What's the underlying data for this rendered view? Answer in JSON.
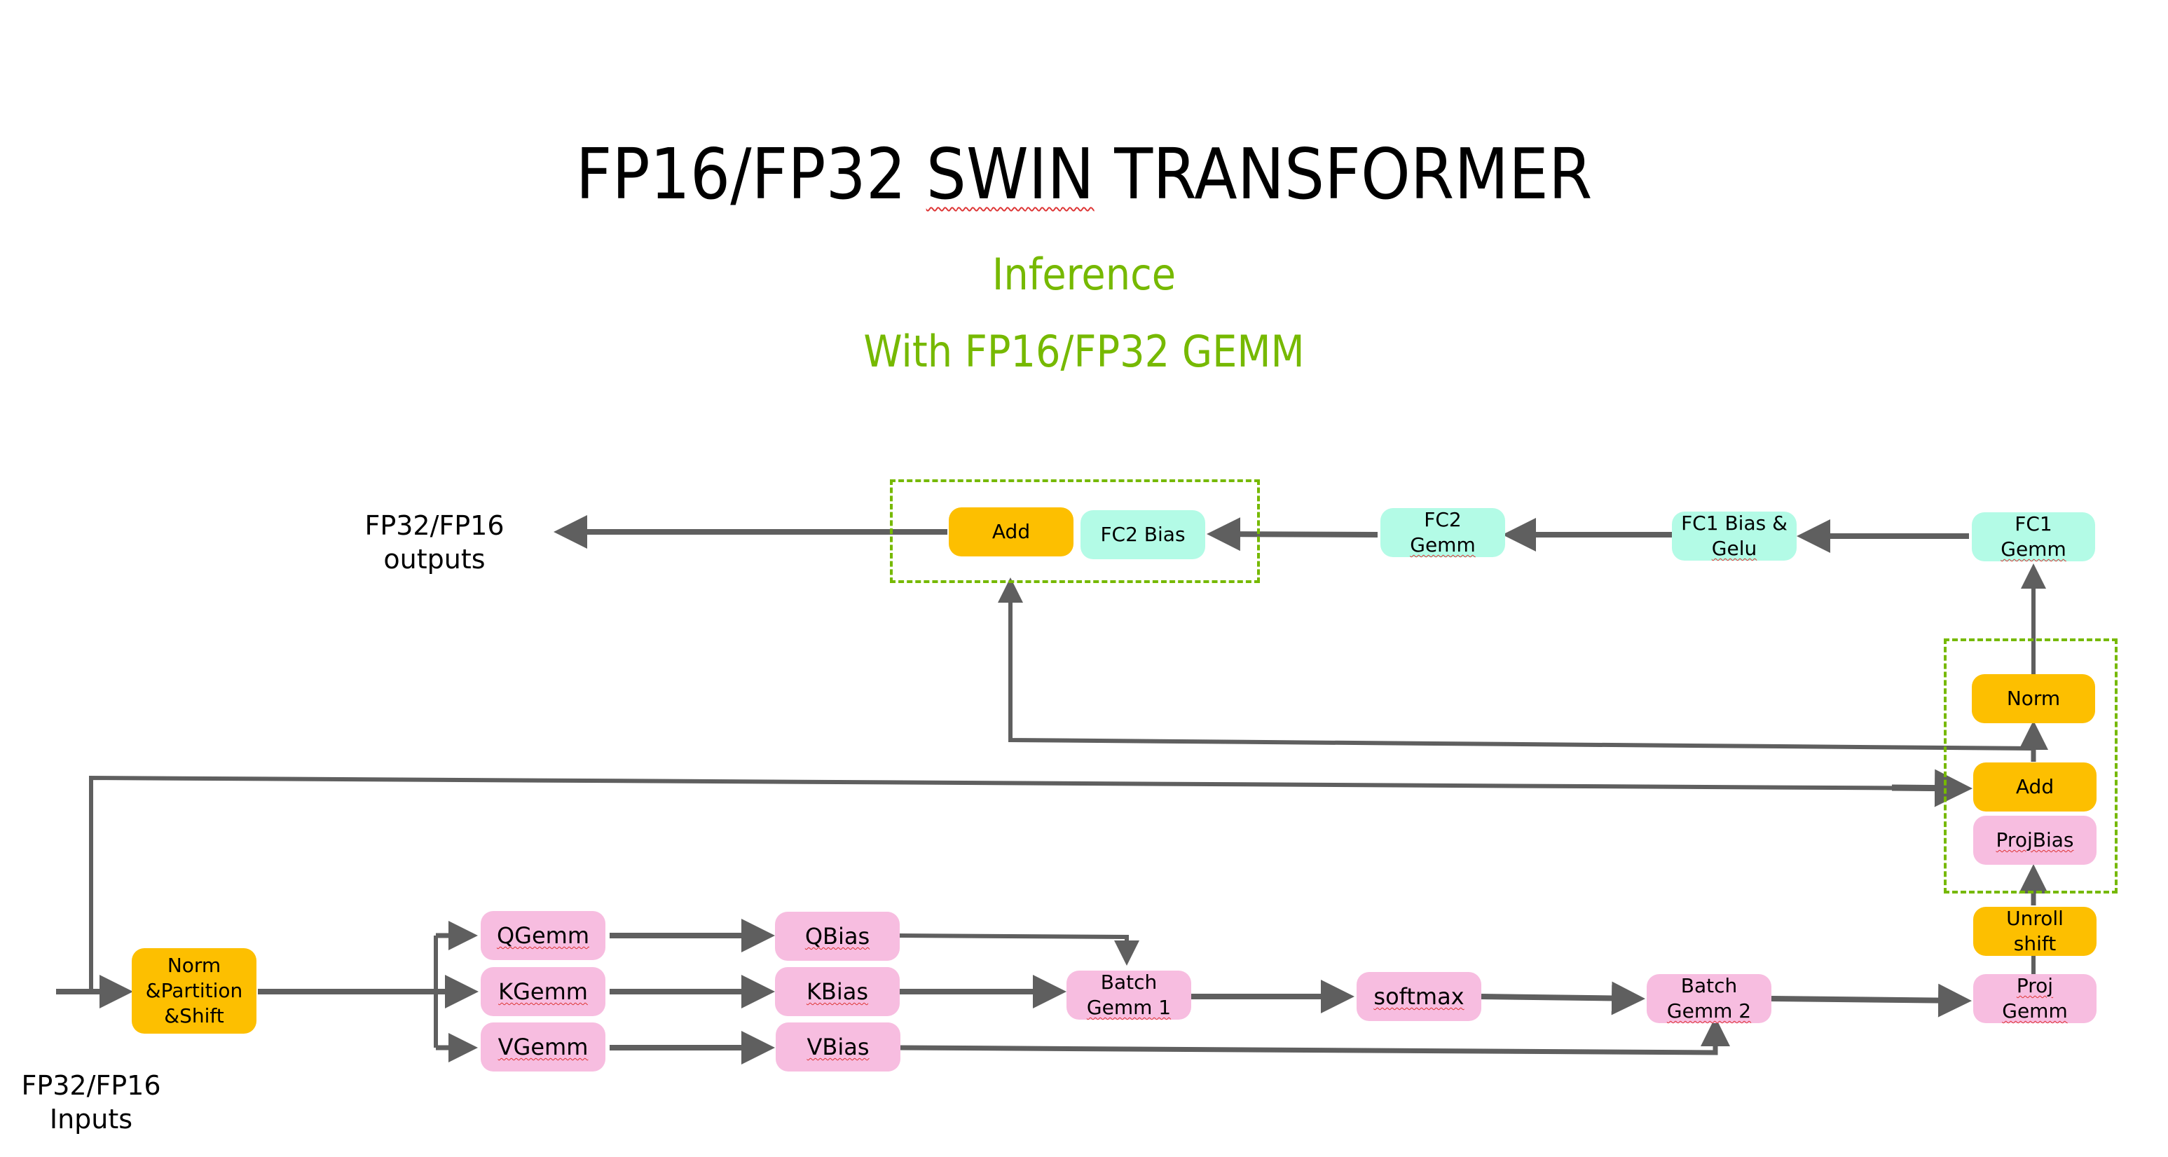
{
  "title": {
    "prefix": "FP16/FP32 ",
    "swin": "SWIN",
    "suffix": " TRANSFORMER"
  },
  "subtitle": {
    "line1": "Inference",
    "line2": "With FP16/FP32 GEMM"
  },
  "colors": {
    "accent_green": "#76b900",
    "orange_block": "#fdbf00",
    "pink_block": "#f7bde0",
    "teal_block": "#b3fbe6",
    "arrow": "#5f5f5f"
  },
  "io": {
    "inputs": {
      "line1": "FP32/FP16",
      "line2": "Inputs"
    },
    "outputs": {
      "line1": "FP32/FP16",
      "line2": "outputs"
    }
  },
  "blocks": {
    "norm_partition_shift": {
      "line1": "Norm",
      "line2": "&Partition",
      "line3": "&Shift"
    },
    "qgemm": "QGemm",
    "kgemm": "KGemm",
    "vgemm": "VGemm",
    "qbias": "QBias",
    "kbias": "KBias",
    "vbias": "VBias",
    "batch_gemm_1": {
      "line1": "Batch",
      "line2": "Gemm 1"
    },
    "softmax": "softmax",
    "batch_gemm_2": {
      "line1": "Batch",
      "line2": "Gemm 2"
    },
    "proj_gemm": {
      "line1": "Proj",
      "line2": "Gemm"
    },
    "unroll_shift": {
      "line1": "Unroll",
      "line2": "shift"
    },
    "proj_bias": "ProjBias",
    "add_1": "Add",
    "norm": "Norm",
    "fc1_gemm": {
      "line1": "FC1",
      "line2": "Gemm"
    },
    "fc1_bias_gelu": {
      "line1": "FC1 Bias &",
      "line2": "Gelu"
    },
    "fc2_gemm": {
      "line1": "FC2",
      "line2": "Gemm"
    },
    "fc2_bias": "FC2 Bias",
    "add_2": "Add"
  }
}
